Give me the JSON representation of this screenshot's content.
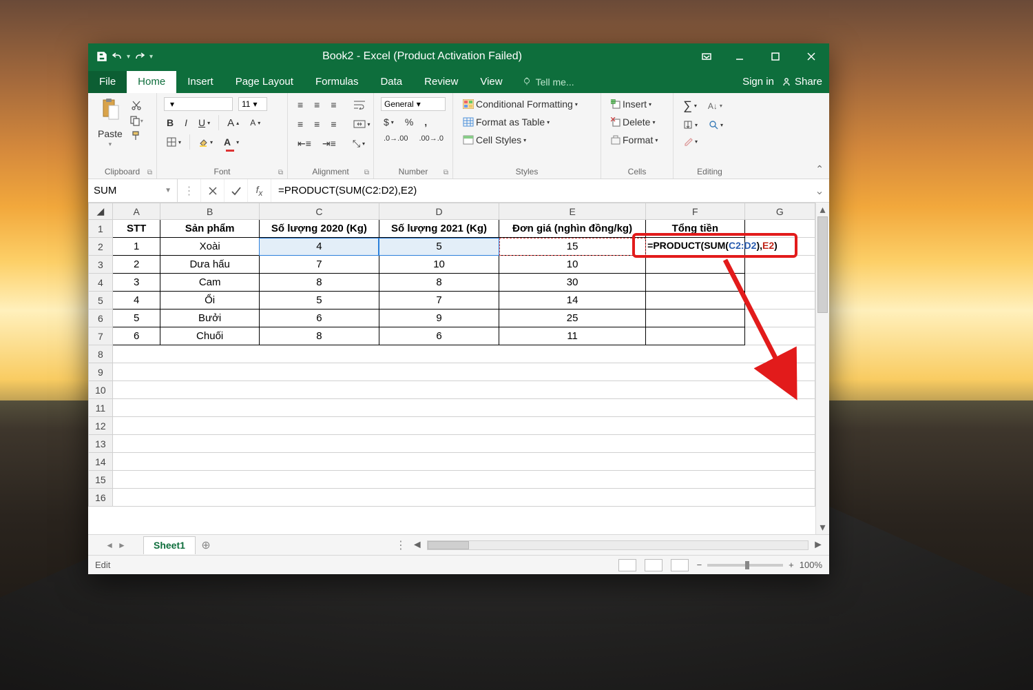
{
  "title": "Book2 - Excel (Product Activation Failed)",
  "menubar": {
    "file": "File",
    "home": "Home",
    "insert": "Insert",
    "pagelayout": "Page Layout",
    "formulas": "Formulas",
    "data": "Data",
    "review": "Review",
    "view": "View",
    "tellme": "Tell me...",
    "signin": "Sign in",
    "share": "Share"
  },
  "ribbon": {
    "paste": "Paste",
    "clipboard": "Clipboard",
    "font": "Font",
    "font_size": "11",
    "alignment": "Alignment",
    "number": "Number",
    "number_format": "General",
    "styles": "Styles",
    "cond_fmt": "Conditional Formatting",
    "fmt_table": "Format as Table",
    "cell_styles": "Cell Styles",
    "cells": "Cells",
    "insert": "Insert",
    "delete": "Delete",
    "format": "Format",
    "editing": "Editing"
  },
  "namebox": "SUM",
  "formula": "=PRODUCT(SUM(C2:D2),E2)",
  "columns": [
    "A",
    "B",
    "C",
    "D",
    "E",
    "F",
    "G"
  ],
  "headers": {
    "A": "STT",
    "B": "Sản phẩm",
    "C": "Số lượng 2020 (Kg)",
    "D": "Số lượng 2021 (Kg)",
    "E": "Đơn giá (nghìn đồng/kg)",
    "F": "Tổng tiền"
  },
  "rows": [
    {
      "A": "1",
      "B": "Xoài",
      "C": "4",
      "D": "5",
      "E": "15"
    },
    {
      "A": "2",
      "B": "Dưa hấu",
      "C": "7",
      "D": "10",
      "E": "10"
    },
    {
      "A": "3",
      "B": "Cam",
      "C": "8",
      "D": "8",
      "E": "30"
    },
    {
      "A": "4",
      "B": "Ổi",
      "C": "5",
      "D": "7",
      "E": "14"
    },
    {
      "A": "5",
      "B": "Bưởi",
      "C": "6",
      "D": "9",
      "E": "25"
    },
    {
      "A": "6",
      "B": "Chuối",
      "C": "8",
      "D": "6",
      "E": "11"
    }
  ],
  "active_cell_formula": {
    "pre": "=PRODUCT(SUM(",
    "ref1": "C2:D2",
    "mid": "),",
    "ref2": "E2",
    "post": ")"
  },
  "sheet_tab": "Sheet1",
  "status_mode": "Edit",
  "zoom": "100%"
}
